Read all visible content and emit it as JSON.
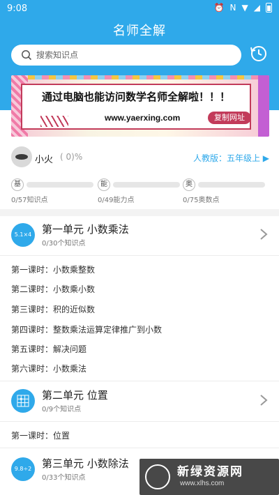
{
  "status_bar": {
    "time": "9:08"
  },
  "header": {
    "title": "名师全解"
  },
  "search": {
    "placeholder": "搜索知识点"
  },
  "banner": {
    "headline": "通过电脑也能访问数学名师全解啦！！！",
    "url": "www.yaerxing.com",
    "copy_label": "复制网址"
  },
  "user": {
    "name": "小火",
    "percent": "( 0)%",
    "edition": "人教版：五年级上 ▶"
  },
  "stats": [
    {
      "badge": "基",
      "label": "0/57知识点",
      "progress": 0
    },
    {
      "badge": "能",
      "label": "0/49能力点",
      "progress": 0
    },
    {
      "badge": "奥",
      "label": "0/75奥数点",
      "progress": 0
    }
  ],
  "units": [
    {
      "icon_text": "5.1×4",
      "title": "第一单元  小数乘法",
      "count": "0/30个知识点",
      "lessons": [
        "第一课时：小数乘整数",
        "第二课时：小数乘小数",
        "第三课时：积的近似数",
        "第四课时：整数乘法运算定律推广到小数",
        "第五课时：解决问题",
        "第六课时：小数乘法"
      ]
    },
    {
      "icon_text": "",
      "title": "第二单元  位置",
      "count": "0/9个知识点",
      "lessons": [
        "第一课时：位置"
      ]
    },
    {
      "icon_text": "9.8÷2",
      "title": "第三单元  小数除法",
      "count": "0/33个知识点",
      "lessons": []
    }
  ],
  "watermark": {
    "name": "新绿资源网",
    "site": "www.xlhs.com"
  },
  "colors": {
    "primary": "#2fa9ea",
    "banner_accent": "#c23b5a"
  },
  "icons": [
    "search-icon",
    "history-icon",
    "chevron-right-icon",
    "avatar",
    "grid-icon"
  ]
}
